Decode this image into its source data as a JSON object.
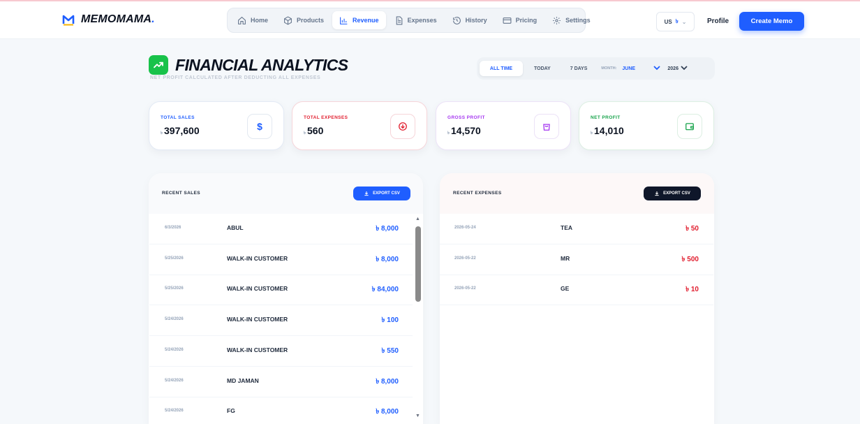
{
  "brand": {
    "name": "MEMOMAMA",
    "dot": "."
  },
  "nav": [
    {
      "label": "Home",
      "icon": "home-icon"
    },
    {
      "label": "Products",
      "icon": "box-icon"
    },
    {
      "label": "Revenue",
      "icon": "bar-chart-icon",
      "active": true
    },
    {
      "label": "Expenses",
      "icon": "document-icon"
    },
    {
      "label": "History",
      "icon": "history-icon"
    },
    {
      "label": "Pricing",
      "icon": "credit-card-icon"
    },
    {
      "label": "Settings",
      "icon": "gear-icon"
    }
  ],
  "language": {
    "code": "US",
    "currency": "৳"
  },
  "header": {
    "profile_label": "Profile",
    "create_label": "Create Memo"
  },
  "page": {
    "title": "FINANCIAL ANALYTICS",
    "subtitle": "NET PROFIT CALCULATED AFTER DEDUCTING ALL EXPENSES"
  },
  "filters": {
    "options": [
      "ALL TIME",
      "TODAY",
      "7 DAYS"
    ],
    "active": "ALL TIME",
    "month_label": "MONTH:",
    "month_value": "JUNE",
    "year_value": "2026"
  },
  "stats": [
    {
      "label": "TOTAL SALES",
      "currency": "৳",
      "value": "397,600",
      "color": "#1f5eff",
      "icon": "dollar-icon"
    },
    {
      "label": "TOTAL EXPENSES",
      "currency": "৳",
      "value": "560",
      "color": "#e11d2e",
      "icon": "arrow-down-circle-icon"
    },
    {
      "label": "GROSS PROFIT",
      "currency": "৳",
      "value": "14,570",
      "color": "#a435f0",
      "icon": "shopping-bag-icon"
    },
    {
      "label": "NET PROFIT",
      "currency": "৳",
      "value": "14,010",
      "color": "#16a34a",
      "icon": "wallet-icon"
    }
  ],
  "recent_sales": {
    "title": "RECENT SALES",
    "export_label": "EXPORT CSV",
    "rows": [
      {
        "date": "6/3/2026",
        "name": "ABUL",
        "amount": "৳ 8,000"
      },
      {
        "date": "5/25/2026",
        "name": "WALK-IN CUSTOMER",
        "amount": "৳ 8,000"
      },
      {
        "date": "5/25/2026",
        "name": "WALK-IN CUSTOMER",
        "amount": "৳ 84,000"
      },
      {
        "date": "5/24/2026",
        "name": "WALK-IN CUSTOMER",
        "amount": "৳ 100"
      },
      {
        "date": "5/24/2026",
        "name": "WALK-IN CUSTOMER",
        "amount": "৳ 550"
      },
      {
        "date": "5/24/2026",
        "name": "MD JAMAN",
        "amount": "৳ 8,000"
      },
      {
        "date": "5/24/2026",
        "name": "FG",
        "amount": "৳ 8,000"
      }
    ]
  },
  "recent_expenses": {
    "title": "RECENT EXPENSES",
    "export_label": "EXPORT CSV",
    "rows": [
      {
        "date": "2026-05-24",
        "name": "TEA",
        "amount": "৳ 50"
      },
      {
        "date": "2026-05-22",
        "name": "MR",
        "amount": "৳ 500"
      },
      {
        "date": "2026-05-22",
        "name": "GE",
        "amount": "৳ 10"
      }
    ]
  }
}
